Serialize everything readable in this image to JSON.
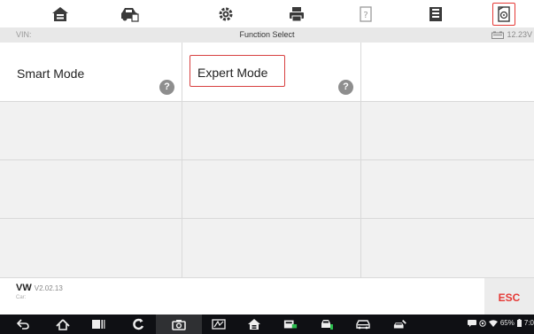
{
  "toolbar": {
    "icons": [
      "home-icon",
      "vehicle-icon",
      "settings-icon",
      "print-icon",
      "help-icon",
      "save-icon",
      "data-logging-icon"
    ]
  },
  "status": {
    "vin_label": "VIN:",
    "title": "Function Select",
    "voltage": "12.23V"
  },
  "grid": {
    "smart_mode": "Smart Mode",
    "expert_mode": "Expert Mode",
    "help_glyph": "?"
  },
  "footer": {
    "make": "VW",
    "version": "V2.02.13",
    "car_label": "Car:",
    "esc_label": "ESC"
  },
  "system": {
    "battery": "65%",
    "clock": "7:0"
  },
  "colors": {
    "accent_red": "#e53935",
    "toolbar_icon": "#3a3a3a"
  }
}
